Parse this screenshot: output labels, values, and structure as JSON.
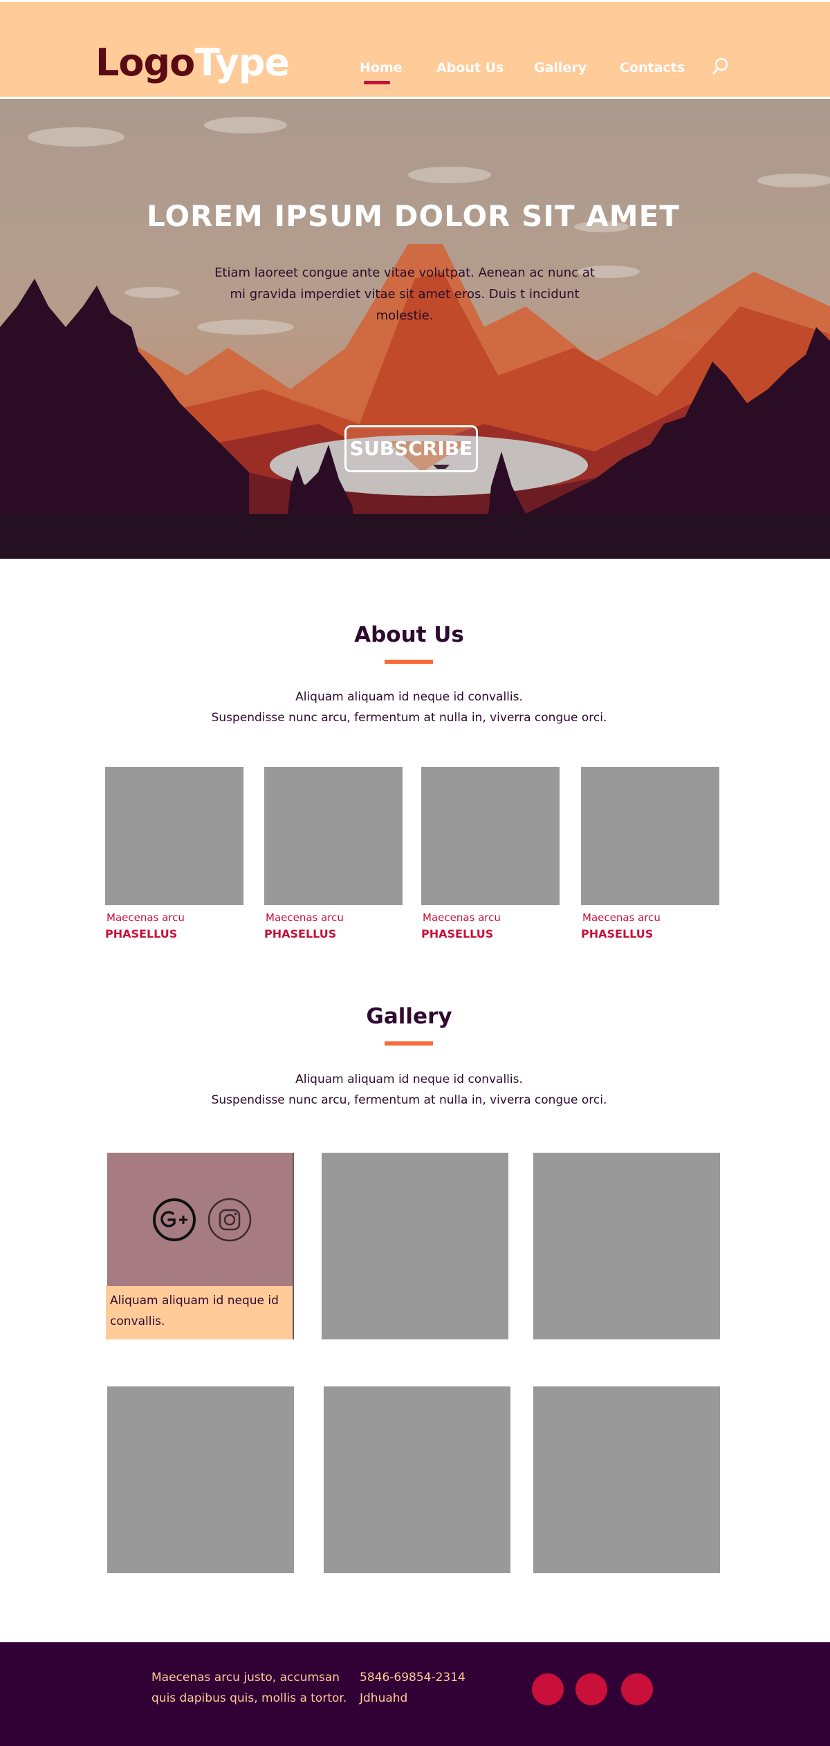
{
  "header": {
    "logo_part1": "Logo",
    "logo_part2": "Type",
    "nav": [
      {
        "label": "Home",
        "active": true
      },
      {
        "label": "About Us"
      },
      {
        "label": "Gallery"
      },
      {
        "label": "Contacts"
      }
    ],
    "search_icon": "search-icon"
  },
  "hero": {
    "title": "LOREM IPSUM DOLOR SIT AMET",
    "text": "Etiam laoreet congue ante vitae volutpat. Aenean ac nunc at mi gravida imperdiet vitae sit amet eros. Duis t incidunt molestie.",
    "button": "SUBSCRIBE"
  },
  "about": {
    "title": "About Us",
    "desc_line1": "Aliquam aliquam id neque id convallis.",
    "desc_line2": "Suspendisse nunc arcu, fermentum at nulla in, viverra congue orci.",
    "cards": [
      {
        "subtitle": "Maecenas arcu",
        "title": "PHASELLUS"
      },
      {
        "subtitle": "Maecenas arcu",
        "title": "PHASELLUS"
      },
      {
        "subtitle": "Maecenas arcu",
        "title": "PHASELLUS"
      },
      {
        "subtitle": "Maecenas arcu",
        "title": "PHASELLUS"
      }
    ]
  },
  "gallery": {
    "title": "Gallery",
    "desc_line1": "Aliquam aliquam id neque id convallis.",
    "desc_line2": "Suspendisse nunc arcu, fermentum at nulla in, viverra congue orci.",
    "hover_caption": "Aliquam aliquam id neque id convallis.",
    "hover_icons": [
      "google-plus-icon",
      "instagram-icon"
    ]
  },
  "footer": {
    "text_line1": "Maecenas arcu justo, accumsan",
    "text_line2": "quis dapibus quis, mollis a tortor.",
    "phone": "5846-69854-2314",
    "extra": "Jdhuahd",
    "social_count": 3
  },
  "colors": {
    "header_bg": "#ffcb99",
    "accent": "#c8103a",
    "title_bar": "#f86c38",
    "dark": "#310034",
    "placeholder": "#999999"
  }
}
